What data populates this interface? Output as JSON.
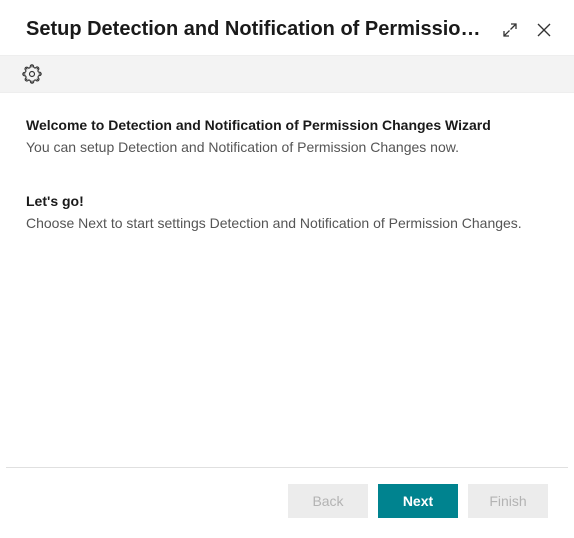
{
  "header": {
    "title": "Setup Detection and Notification of Permission ..."
  },
  "content": {
    "welcome_heading": "Welcome to Detection and Notification of Permission Changes Wizard",
    "welcome_text": "You can setup Detection and Notification of Permission Changes now.",
    "letsgo_heading": "Let's go!",
    "letsgo_text": "Choose Next to start settings Detection and Notification of Permission Changes."
  },
  "footer": {
    "back_label": "Back",
    "next_label": "Next",
    "finish_label": "Finish"
  }
}
